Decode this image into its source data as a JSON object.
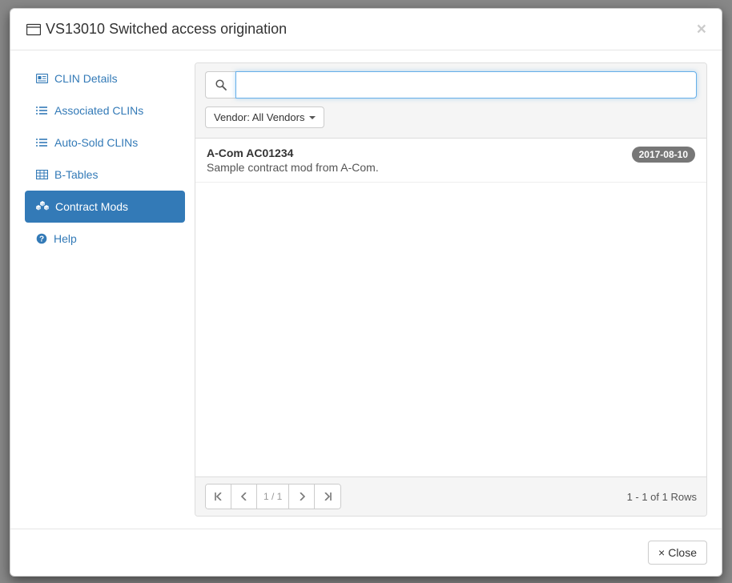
{
  "modal": {
    "title": "VS13010 Switched access origination"
  },
  "sidebar": {
    "items": [
      {
        "label": "CLIN Details",
        "icon": "card-icon",
        "active": false
      },
      {
        "label": "Associated CLINs",
        "icon": "list-icon",
        "active": false
      },
      {
        "label": "Auto-Sold CLINs",
        "icon": "list-icon",
        "active": false
      },
      {
        "label": "B-Tables",
        "icon": "table-icon",
        "active": false
      },
      {
        "label": "Contract Mods",
        "icon": "cubes-icon",
        "active": true
      },
      {
        "label": "Help",
        "icon": "help-icon",
        "active": false
      }
    ]
  },
  "search": {
    "value": "",
    "placeholder": ""
  },
  "filter": {
    "vendor_label": "Vendor: All Vendors"
  },
  "results": [
    {
      "title": "A-Com AC01234",
      "description": "Sample contract mod from A-Com.",
      "date": "2017-08-10"
    }
  ],
  "pager": {
    "page_text": "1 / 1",
    "rows_text": "1 - 1 of 1 Rows"
  },
  "footer": {
    "close_label": "Close"
  }
}
